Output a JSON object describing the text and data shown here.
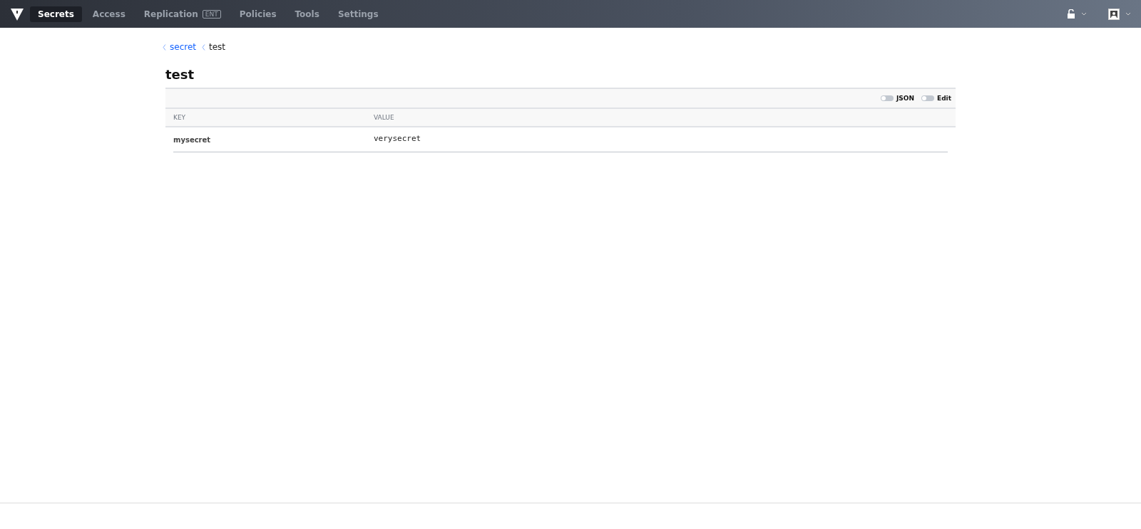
{
  "nav": {
    "items": [
      {
        "label": "Secrets",
        "selected": true
      },
      {
        "label": "Access",
        "selected": false
      },
      {
        "label": "Replication",
        "selected": false,
        "badge": "ENT"
      },
      {
        "label": "Policies",
        "selected": false
      },
      {
        "label": "Tools",
        "selected": false
      },
      {
        "label": "Settings",
        "selected": false
      }
    ]
  },
  "breadcrumbs": [
    {
      "label": "secret",
      "kind": "link"
    },
    {
      "label": "test",
      "kind": "current"
    }
  ],
  "title": "test",
  "toolbar": {
    "toggles": [
      {
        "label": "JSON",
        "on": false
      },
      {
        "label": "Edit",
        "on": false
      }
    ]
  },
  "table": {
    "columns": [
      "KEY",
      "VALUE"
    ],
    "rows": [
      {
        "key": "mysecret",
        "value": "verysecret"
      }
    ]
  }
}
